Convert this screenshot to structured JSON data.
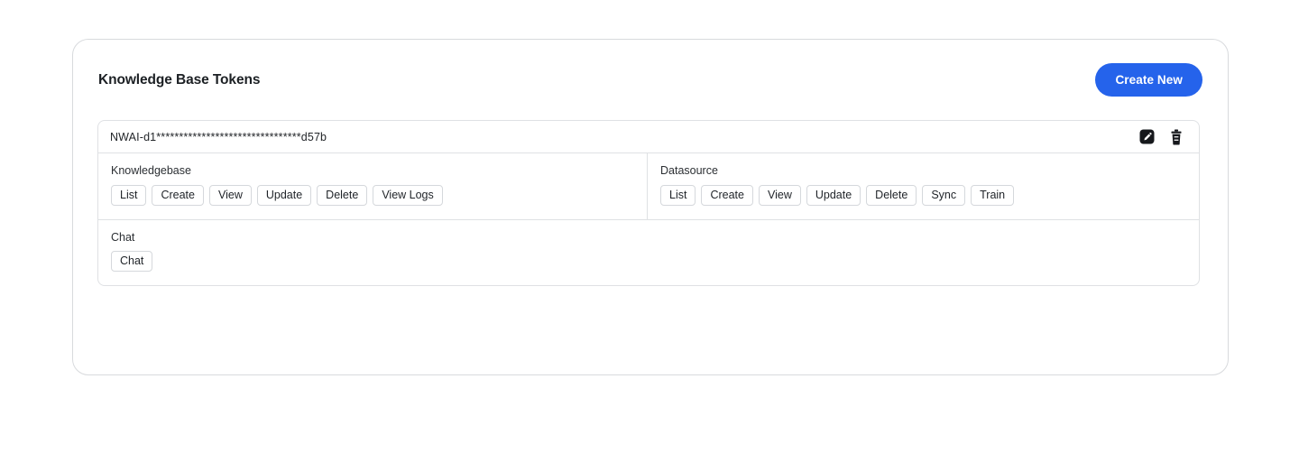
{
  "card": {
    "title": "Knowledge Base Tokens",
    "create_new_label": "Create New",
    "accent_color": "#2563eb",
    "border_color": "#d8dadd"
  },
  "token": {
    "masked_value": "NWAI-d1********************************d57b",
    "edit_icon": "edit-pencil-icon",
    "delete_icon": "trash-icon"
  },
  "permission_groups": [
    {
      "label": "Knowledgebase",
      "buttons": [
        "List",
        "Create",
        "View",
        "Update",
        "Delete",
        "View Logs"
      ]
    },
    {
      "label": "Datasource",
      "buttons": [
        "List",
        "Create",
        "View",
        "Update",
        "Delete",
        "Sync",
        "Train"
      ]
    },
    {
      "label": "Chat",
      "buttons": [
        "Chat"
      ]
    }
  ]
}
